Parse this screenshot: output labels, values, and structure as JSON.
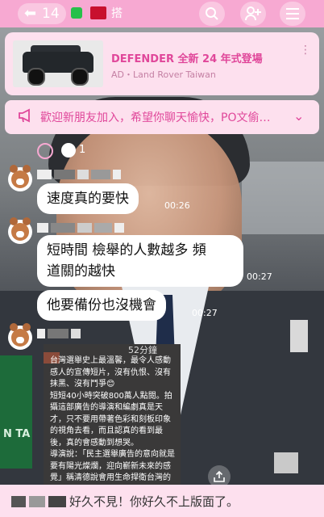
{
  "topbar": {
    "back_arrow": "⬅",
    "unread_count": "14",
    "title_fragment": "搭",
    "icons": [
      "search-icon",
      "add-friend-icon",
      "menu-icon"
    ]
  },
  "ad": {
    "title": "DEFENDER 全新 24 年式登場",
    "sponsor": "AD・Land Rover Taiwan",
    "more": "⋮"
  },
  "announcement": {
    "text": "歡迎新朋友加入，希望你聊天愉快，PO文偷…",
    "chevron": "⌄"
  },
  "reactions": {
    "count": "1"
  },
  "messages": [
    {
      "text": "速度真的要快",
      "time": "00:26"
    },
    {
      "text": "短時間 檢舉的人數越多 頻道關的越快",
      "line1": "短時間 檢舉的人數越多 頻",
      "line2": "道關的越快",
      "time": "00:27"
    },
    {
      "text": "他要備份也沒機會",
      "time": "00:27"
    }
  ],
  "post": {
    "time": "52分鐘",
    "body": "台灣選舉史上最溫馨，最令人感動感人的宣傳短片，沒有仇恨、沒有抹黑、沒有鬥爭😊\n短短40小時突破800萬人點閱。拍攝這部廣告的導演和編劇真是天才，只不要用帶著色彩和刻板印象的視角去看，而且認真的看到最後，真的會感動到想哭。\n導演說：「民主選舉廣告的意向就是要有陽光燦爛，迎向嶄新未來的感覺」稱清德說會用生命捍衛台灣的民主自由，每個人看完後，都真"
  },
  "bottom": {
    "text": "好久不見！你好久不上版面了。"
  },
  "colors": {
    "accent": "#f7a9d2",
    "accent_text": "#e0479a",
    "panel": "#fde0ee"
  }
}
